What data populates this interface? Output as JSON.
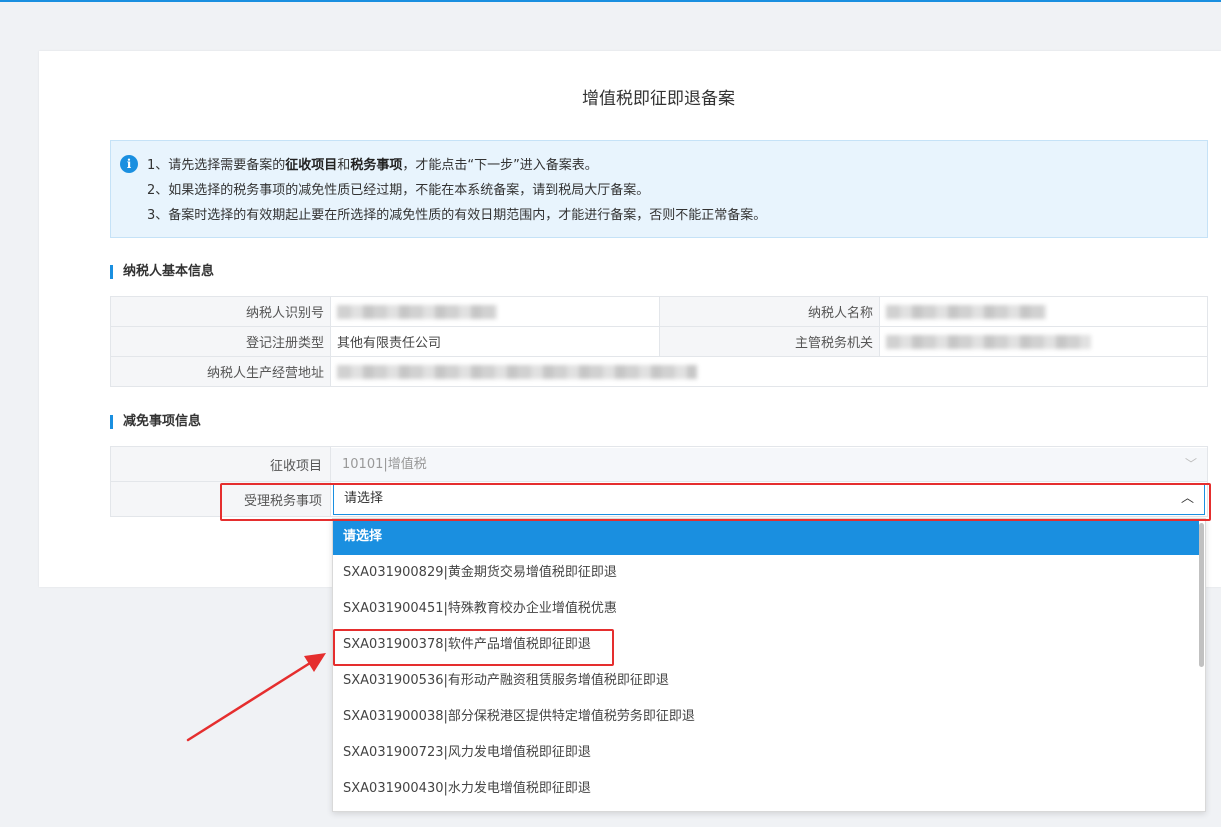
{
  "page": {
    "title": "增值税即征即退备案"
  },
  "notice": {
    "line1_prefix": "1、请先选择需要备案的",
    "line1_bold1": "征收项目",
    "line1_mid": "和",
    "line1_bold2": "税务事项",
    "line1_suffix": "，才能点击“下一步”进入备案表。",
    "line2": "2、如果选择的税务事项的减免性质已经过期，不能在本系统备案，请到税局大厅备案。",
    "line3": "3、备案时选择的有效期起止要在所选择的减免性质的有效日期范围内，才能进行备案，否则不能正常备案。"
  },
  "taxpayer": {
    "section_title": "纳税人基本信息",
    "id_label": "纳税人识别号",
    "name_label": "纳税人名称",
    "reg_type_label": "登记注册类型",
    "reg_type_value": "其他有限责任公司",
    "authority_label": "主管税务机关",
    "address_label": "纳税人生产经营地址"
  },
  "exemption": {
    "section_title": "减免事项信息",
    "levy_label": "征收项目",
    "levy_value": "10101|增值税",
    "matter_label": "受理税务事项",
    "matter_value": "请选择"
  },
  "dropdown": {
    "options": [
      "请选择",
      "SXA031900829|黄金期货交易增值税即征即退",
      "SXA031900451|特殊教育校办企业增值税优惠",
      "SXA031900378|软件产品增值税即征即退",
      "SXA031900536|有形动产融资租赁服务增值税即征即退",
      "SXA031900038|部分保税港区提供特定增值税劳务即征即退",
      "SXA031900723|风力发电增值税即征即退",
      "SXA031900430|水力发电增值税即征即退"
    ],
    "selected_index": 0,
    "highlighted_index": 3
  },
  "colors": {
    "accent": "#1a8fe0",
    "annotation_red": "#e52e2e",
    "notice_bg": "#e8f4fd"
  }
}
